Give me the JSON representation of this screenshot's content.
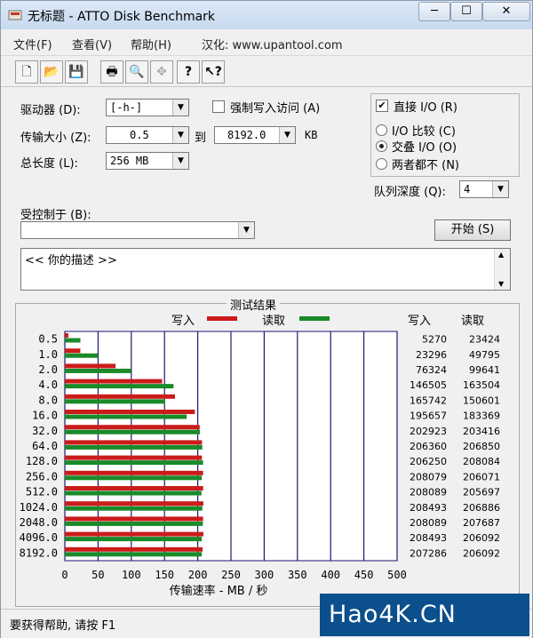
{
  "window": {
    "title": "无标题 - ATTO Disk Benchmark",
    "app_icon": "atto-app-icon"
  },
  "caption_buttons": {
    "minimize": "─",
    "maximize": "☐",
    "close": "✕"
  },
  "menu": [
    {
      "label": "文件(F)"
    },
    {
      "label": "查看(V)"
    },
    {
      "label": "帮助(H)"
    },
    {
      "label": "汉化: www.upantool.com"
    }
  ],
  "toolbar": [
    {
      "icon": "new-file-icon",
      "glyph": "🗋"
    },
    {
      "icon": "open-folder-icon",
      "glyph": "📂"
    },
    {
      "icon": "save-icon",
      "glyph": "💾"
    },
    {
      "icon": "print-icon",
      "glyph": "🖶"
    },
    {
      "icon": "print-preview-icon",
      "glyph": "🔍"
    },
    {
      "icon": "move-icon",
      "glyph": "✥"
    },
    {
      "icon": "help-icon",
      "glyph": "?"
    },
    {
      "icon": "context-help-icon",
      "glyph": "↖?"
    }
  ],
  "settings": {
    "drive_label": "驱动器 (D):",
    "drive_value": "[-h-]",
    "transfer_label": "传输大小 (Z):",
    "transfer_from": "0.5",
    "transfer_to_label": "到",
    "transfer_to": "8192.0",
    "transfer_unit": "KB",
    "total_label": "总长度 (L):",
    "total_value": "256 MB",
    "force_write_label": "强制写入访问 (A)",
    "force_write_checked": false,
    "direct_io_label": "直接 I/O (R)",
    "direct_io_checked": true,
    "io_compare_label": "I/O 比较 (C)",
    "overlap_io_label": "交叠 I/O (O)",
    "neither_label": "两者都不 (N)",
    "selected_mode": "overlap",
    "queue_label": "队列深度 (Q):",
    "queue_value": "4",
    "controlled_label": "受控制于 (B):",
    "controlled_value": "",
    "start_button": "开始 (S)",
    "description": "<<  你的描述  >>"
  },
  "results": {
    "title": "测试结果",
    "write_legend": "写入",
    "read_legend": "读取",
    "col_write": "写入",
    "col_read": "读取",
    "write_color": "#cc1b1b",
    "read_color": "#1a8a2a"
  },
  "chart_data": {
    "type": "bar",
    "orientation": "horizontal",
    "categories": [
      "0.5",
      "1.0",
      "2.0",
      "4.0",
      "8.0",
      "16.0",
      "32.0",
      "64.0",
      "128.0",
      "256.0",
      "512.0",
      "1024.0",
      "2048.0",
      "4096.0",
      "8192.0"
    ],
    "series": [
      {
        "name": "写入",
        "values": [
          5270,
          23296,
          76324,
          146505,
          165742,
          195657,
          202923,
          206360,
          206250,
          208079,
          208089,
          208493,
          208089,
          208493,
          207286
        ]
      },
      {
        "name": "读取",
        "values": [
          23424,
          49795,
          99641,
          163504,
          150601,
          183369,
          203416,
          206850,
          208084,
          206071,
          205697,
          206886,
          207687,
          206092,
          206092
        ]
      }
    ],
    "xticks": [
      0,
      50,
      100,
      150,
      200,
      250,
      300,
      350,
      400,
      450,
      500
    ],
    "xlabel": "传输速率 - MB / 秒",
    "xlim": [
      0,
      500
    ],
    "value_scale_per_mb": 1000,
    "grid": "vertical"
  },
  "status": {
    "text": "要获得帮助, 请按 F1"
  },
  "watermark": {
    "text": "Hao4K.CN"
  }
}
